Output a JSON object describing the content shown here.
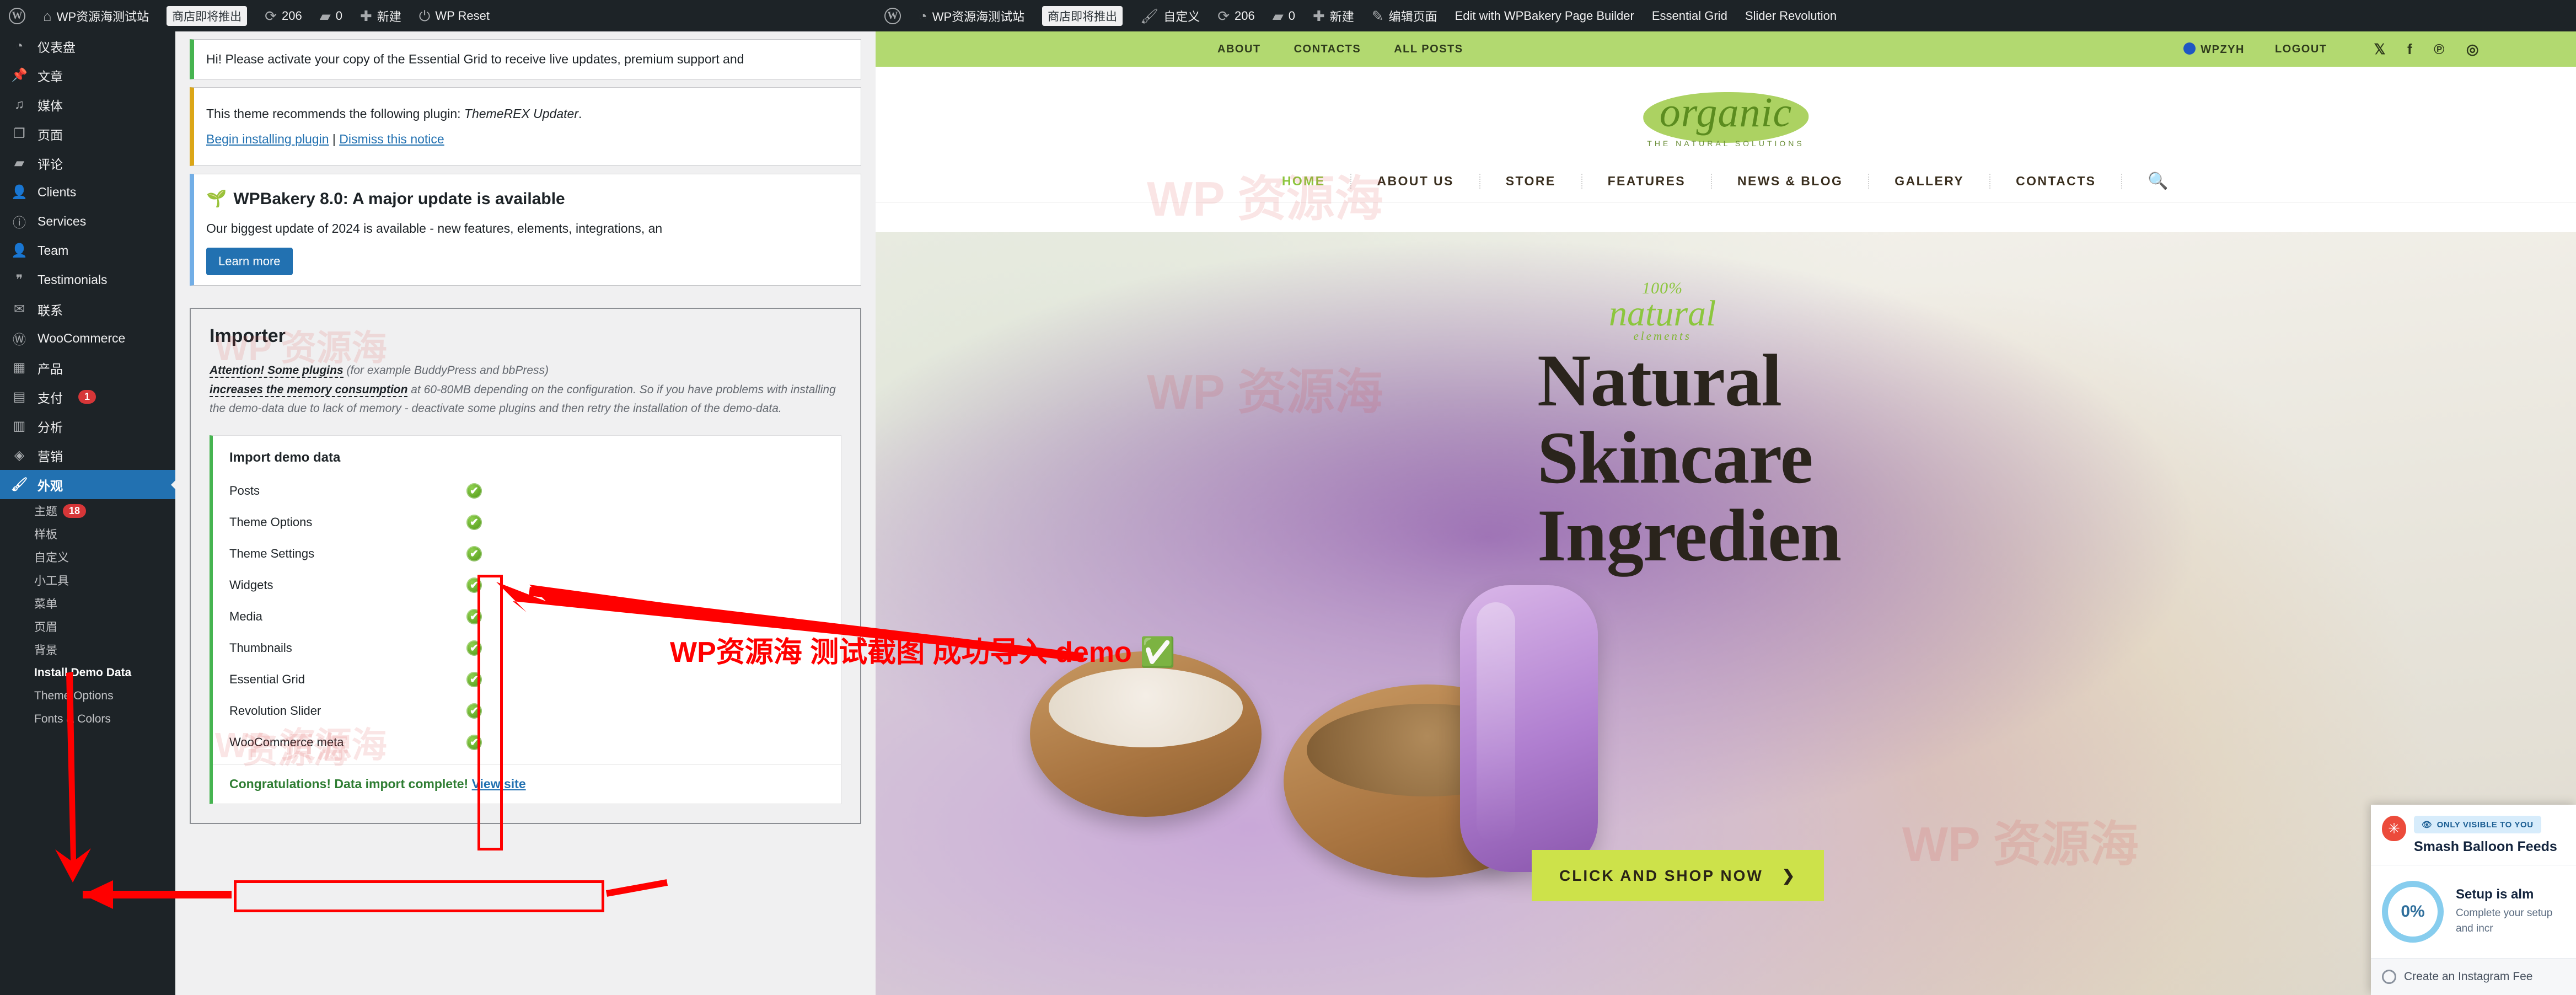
{
  "admin_bar_left": {
    "site_title": "WP资源海测试站",
    "badge": "商店即将推出",
    "updates": "206",
    "comments": "0",
    "new": "新建",
    "wp_reset": "WP Reset"
  },
  "admin_bar_right": {
    "site_title": "WP资源海测试站",
    "badge": "商店即将推出",
    "customize": "自定义",
    "updates": "206",
    "comments": "0",
    "new": "新建",
    "edit_page": "编辑页面",
    "wpbakery": "Edit with WPBakery Page Builder",
    "essential_grid": "Essential Grid",
    "slider_revolution": "Slider Revolution"
  },
  "sidebar": {
    "items": [
      {
        "label": "仪表盘",
        "icon": "dashboard-icon",
        "glyph": "◔"
      },
      {
        "label": "文章",
        "icon": "posts-pin-icon",
        "glyph": "✎"
      },
      {
        "label": "媒体",
        "icon": "media-icon",
        "glyph": "♫"
      },
      {
        "label": "页面",
        "icon": "pages-icon",
        "glyph": "❐"
      },
      {
        "label": "评论",
        "icon": "comments-icon",
        "glyph": "▰"
      },
      {
        "label": "Clients",
        "icon": "user-icon",
        "glyph": "👤"
      },
      {
        "label": "Services",
        "icon": "info-icon",
        "glyph": "ⓘ"
      },
      {
        "label": "Team",
        "icon": "team-icon",
        "glyph": "👤"
      },
      {
        "label": "Testimonials",
        "icon": "quote-icon",
        "glyph": "❞"
      },
      {
        "label": "联系",
        "icon": "contact-icon",
        "glyph": "✉"
      },
      {
        "label": "WooCommerce",
        "icon": "woocommerce-icon",
        "glyph": "Ⓦ"
      },
      {
        "label": "产品",
        "icon": "products-icon",
        "glyph": "▦"
      },
      {
        "label": "支付",
        "icon": "payments-icon",
        "glyph": "▤",
        "badge": "1"
      },
      {
        "label": "分析",
        "icon": "analytics-icon",
        "glyph": "▥"
      },
      {
        "label": "营销",
        "icon": "marketing-icon",
        "glyph": "◈"
      }
    ],
    "appearance": {
      "label": "外观",
      "icon": "appearance-brush-icon",
      "glyph": "🖌"
    },
    "appearance_sub": [
      {
        "label": "主题",
        "badge": "18"
      },
      {
        "label": "样板"
      },
      {
        "label": "自定义"
      },
      {
        "label": "小工具"
      },
      {
        "label": "菜单"
      },
      {
        "label": "页眉"
      },
      {
        "label": "背景"
      },
      {
        "label": "Install Demo Data",
        "active": true
      },
      {
        "label": "Theme Options"
      },
      {
        "label": "Fonts & Colors"
      }
    ]
  },
  "notices": {
    "essential_grid": "Hi! Please activate your copy of the Essential Grid to receive live updates, premium support and",
    "themerex": {
      "text_before": "This theme recommends the following plugin: ",
      "plugin": "ThemeREX Updater",
      "text_after": ".",
      "link_install": "Begin installing plugin",
      "separator": "|",
      "link_dismiss": "Dismiss this notice"
    },
    "wpbakery": {
      "title": "WPBakery 8.0: A major update is available",
      "body": "Our biggest update of 2024 is available - new features, elements, integrations, an",
      "button": "Learn more"
    }
  },
  "importer": {
    "heading": "Importer",
    "attention_1": "Attention! Some plugins",
    "attention_1_rest": " (for example BuddyPress and bbPress)",
    "attention_2": "increases the memory consumption",
    "attention_2_rest": " at 60-80MB depending on the configuration. So if you have problems with installing the demo-data due to lack of memory - deactivate some plugins and then retry the installation of the demo-data.",
    "box_title": "Import demo data",
    "rows": [
      {
        "label": "Posts",
        "status": "done"
      },
      {
        "label": "Theme Options",
        "status": "done"
      },
      {
        "label": "Theme Settings",
        "status": "done"
      },
      {
        "label": "Widgets",
        "status": "done"
      },
      {
        "label": "Media",
        "status": "done"
      },
      {
        "label": "Thumbnails",
        "status": "done"
      },
      {
        "label": "Essential Grid",
        "status": "done"
      },
      {
        "label": "Revolution Slider",
        "status": "done"
      },
      {
        "label": "WooCommerce meta",
        "status": "done"
      }
    ],
    "complete_text": "Congratulations! Data import complete!",
    "complete_link": "View site",
    "tick_glyph": "✔"
  },
  "site_preview": {
    "topbar_left": [
      "ABOUT",
      "CONTACTS",
      "ALL POSTS"
    ],
    "account": "WPZYH",
    "logout": "LOGOUT",
    "social": [
      "𝕏",
      "f",
      "℗",
      "◎"
    ],
    "logo_word": "organic",
    "logo_sub": "THE NATURAL SOLUTIONS",
    "nav": [
      "HOME",
      "ABOUT US",
      "STORE",
      "FEATURES",
      "NEWS & BLOG",
      "GALLERY",
      "CONTACTS"
    ],
    "nav_active": "HOME",
    "search_icon": "search-icon",
    "hero": {
      "script_100": "100%",
      "script_natural": "natural",
      "script_elements": "elements",
      "line1": "Natural",
      "line2": "Skincare",
      "line3": "Ingredien",
      "cta": "CLICK AND SHOP NOW",
      "cta_arrow": "❯"
    }
  },
  "smash_balloon": {
    "pill": "ONLY VISIBLE TO YOU",
    "pill_icon": "eye-icon",
    "title": "Smash Balloon Feeds",
    "progress": "0%",
    "setup_title": "Setup is alm",
    "setup_body": "Complete your setup and incr",
    "checklist_item": "Create an Instagram Fee"
  },
  "annotations": {
    "overlay_text": "WP资源海 测试截图 成功导入 demo",
    "overlay_check": "✅",
    "watermark": "WP 资源海",
    "watermark_short": "资源海"
  }
}
